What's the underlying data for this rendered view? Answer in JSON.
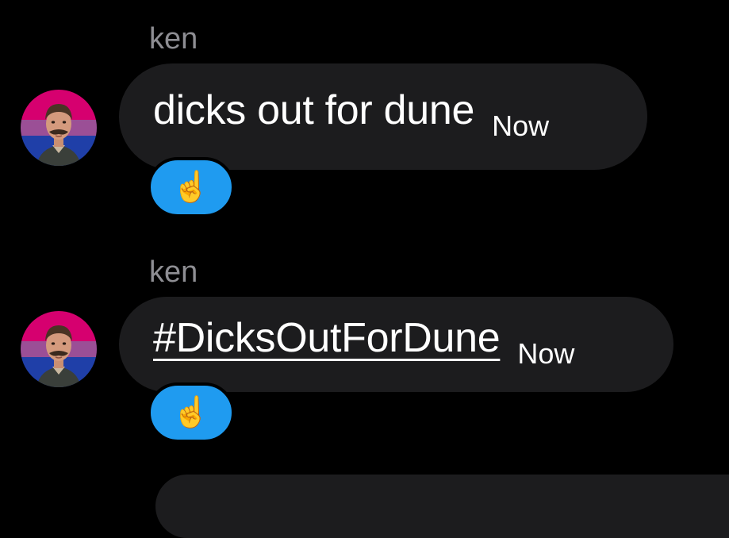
{
  "messages": [
    {
      "sender": "ken",
      "text": "dicks out for dune",
      "is_link": false,
      "timestamp": "Now",
      "reaction": "☝️"
    },
    {
      "sender": "ken",
      "text": "#DicksOutForDune",
      "is_link": true,
      "timestamp": "Now",
      "reaction": "☝️"
    }
  ],
  "colors": {
    "background": "#000000",
    "bubble": "#1c1c1e",
    "sender_name": "#8e8e93",
    "reaction_bg": "#1f9bf0",
    "text": "#ffffff"
  },
  "icons": {
    "avatar": "profile-photo-bisexual-flag-avatar",
    "reaction": "pointing-up-emoji"
  }
}
